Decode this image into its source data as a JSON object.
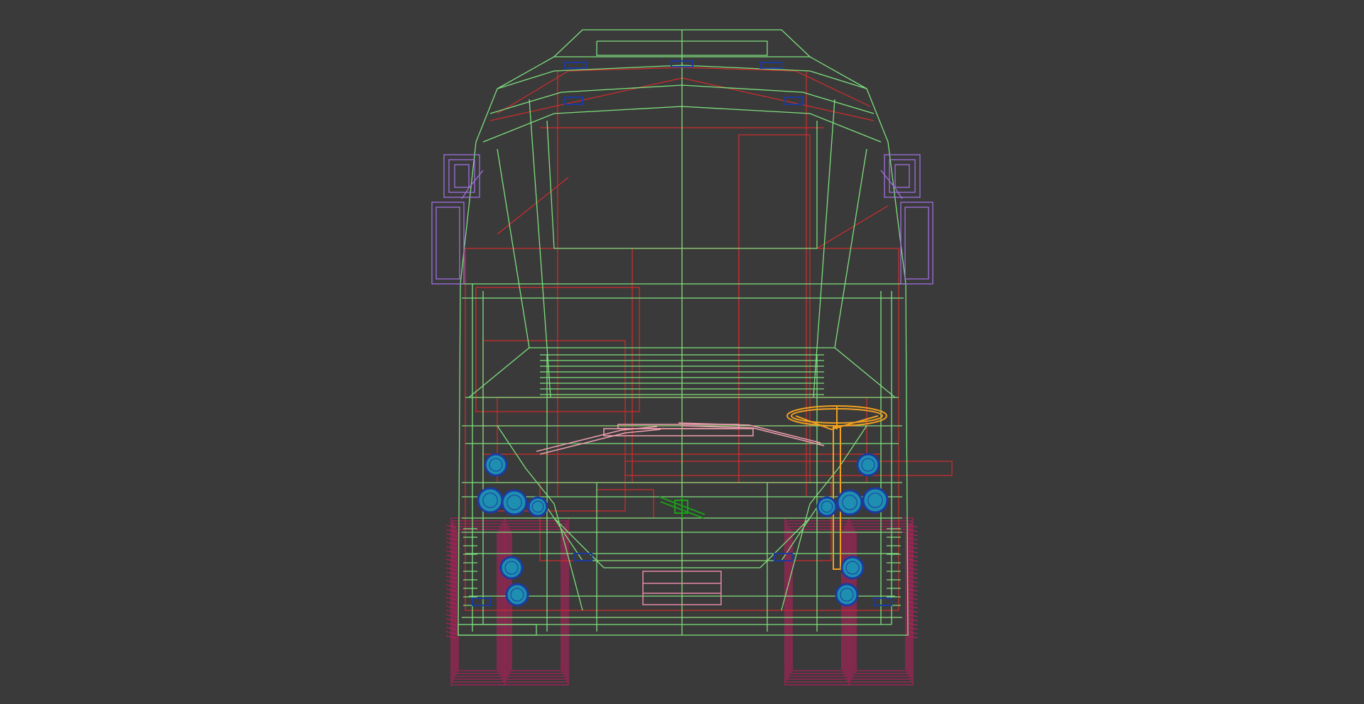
{
  "viewport": {
    "background": "#3a3a3a",
    "render_mode": "wireframe",
    "view": "front"
  },
  "model": {
    "subject": "bus",
    "wire_colors": {
      "body": "#7ee07e",
      "interior": "#d42c2c",
      "mirrors": "#a070e0",
      "wheels": "#b0205a",
      "lights_fill": "#1e8fb0",
      "lights_edge": "#1c3aa0",
      "steering": "#f0a020",
      "wipers": "#f0a0b0",
      "plate": "#e88aa8",
      "pivot": "#1aa01a"
    },
    "parts": [
      {
        "name": "body-shell",
        "color_key": "body"
      },
      {
        "name": "interior-frame",
        "color_key": "interior"
      },
      {
        "name": "left-mirror",
        "color_key": "mirrors"
      },
      {
        "name": "right-mirror",
        "color_key": "mirrors"
      },
      {
        "name": "left-wheels",
        "color_key": "wheels"
      },
      {
        "name": "right-wheels",
        "color_key": "wheels"
      },
      {
        "name": "headlights-left",
        "color_key": "lights_fill"
      },
      {
        "name": "headlights-right",
        "color_key": "lights_fill"
      },
      {
        "name": "steering-wheel",
        "color_key": "steering"
      },
      {
        "name": "wipers",
        "color_key": "wipers"
      },
      {
        "name": "license-plate",
        "color_key": "plate"
      },
      {
        "name": "pivot-gizmo",
        "color_key": "pivot"
      }
    ]
  }
}
